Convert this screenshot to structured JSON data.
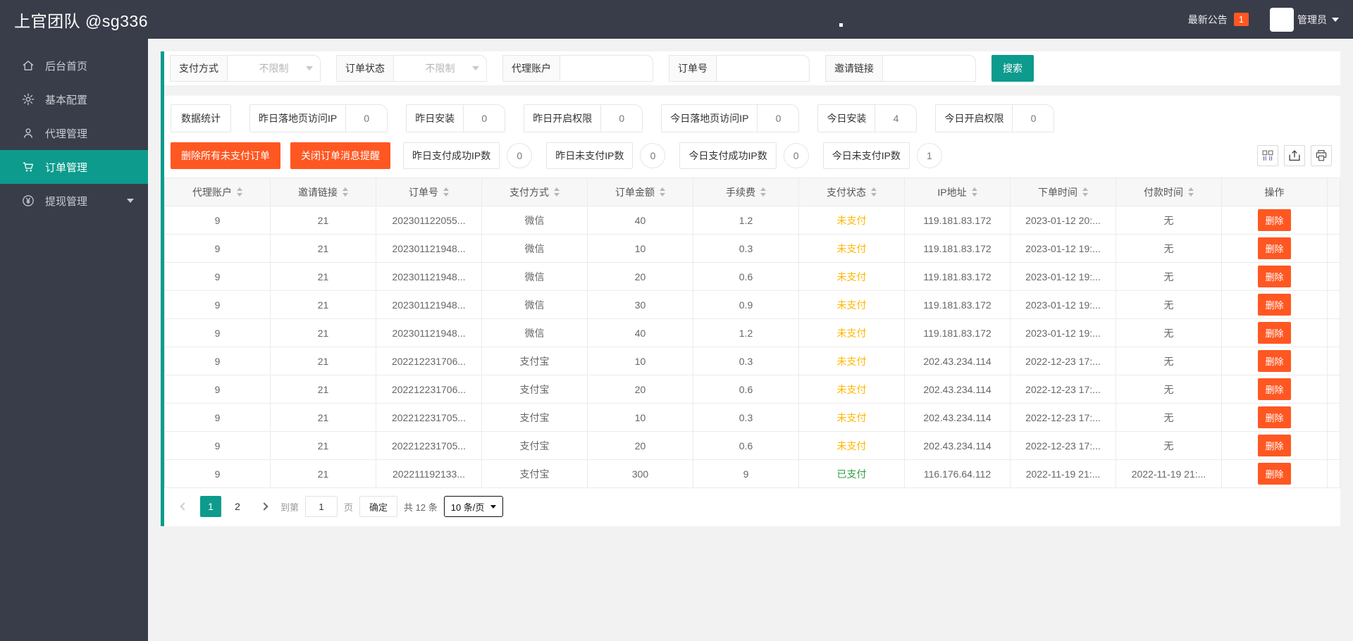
{
  "header": {
    "title": "上官团队 @sg336",
    "announcement_label": "最新公告",
    "announcement_count": "1",
    "user_label": "管理员"
  },
  "sidebar": {
    "items": [
      {
        "label": "后台首页",
        "icon": "home-icon",
        "active": false,
        "has_submenu": false
      },
      {
        "label": "基本配置",
        "icon": "gear-icon",
        "active": false,
        "has_submenu": false
      },
      {
        "label": "代理管理",
        "icon": "users-icon",
        "active": false,
        "has_submenu": false
      },
      {
        "label": "订单管理",
        "icon": "cart-icon",
        "active": true,
        "has_submenu": false
      },
      {
        "label": "提现管理",
        "icon": "yen-icon",
        "active": false,
        "has_submenu": true
      }
    ]
  },
  "filters": {
    "groups": [
      {
        "label": "支付方式",
        "type": "select",
        "value": "不限制"
      },
      {
        "label": "订单状态",
        "type": "select",
        "value": "不限制"
      },
      {
        "label": "代理账户",
        "type": "input",
        "value": ""
      },
      {
        "label": "订单号",
        "type": "input",
        "value": ""
      },
      {
        "label": "邀请链接",
        "type": "input",
        "value": ""
      }
    ],
    "search_label": "搜索"
  },
  "stats": {
    "title": "数据统计",
    "items": [
      {
        "label": "昨日落地页访问IP",
        "value": "0"
      },
      {
        "label": "昨日安装",
        "value": "0"
      },
      {
        "label": "昨日开启权限",
        "value": "0"
      },
      {
        "label": "今日落地页访问IP",
        "value": "0"
      },
      {
        "label": "今日安装",
        "value": "4"
      },
      {
        "label": "今日开启权限",
        "value": "0"
      }
    ]
  },
  "actions": {
    "buttons": [
      {
        "label": "删除所有未支付订单"
      },
      {
        "label": "关闭订单消息提醒"
      }
    ],
    "counters": [
      {
        "label": "昨日支付成功IP数",
        "value": "0"
      },
      {
        "label": "昨日未支付IP数",
        "value": "0"
      },
      {
        "label": "今日支付成功IP数",
        "value": "0"
      },
      {
        "label": "今日未支付IP数",
        "value": "1"
      }
    ],
    "tools": [
      {
        "name": "columns-icon"
      },
      {
        "name": "export-icon"
      },
      {
        "name": "print-icon"
      }
    ]
  },
  "table": {
    "columns": [
      {
        "label": "代理账户",
        "sortable": true
      },
      {
        "label": "邀请链接",
        "sortable": true
      },
      {
        "label": "订单号",
        "sortable": true
      },
      {
        "label": "支付方式",
        "sortable": true
      },
      {
        "label": "订单金额",
        "sortable": true
      },
      {
        "label": "手续费",
        "sortable": true
      },
      {
        "label": "支付状态",
        "sortable": true
      },
      {
        "label": "IP地址",
        "sortable": true
      },
      {
        "label": "下单时间",
        "sortable": true
      },
      {
        "label": "付款时间",
        "sortable": true
      },
      {
        "label": "操作",
        "sortable": false
      }
    ],
    "row_action_label": "删除",
    "status_styles": {
      "未支付": "#ffb800",
      "已支付": "#2f9e44"
    },
    "rows": [
      {
        "agent": "9",
        "invite": "21",
        "order_no": "202301122055...",
        "pay_method": "微信",
        "amount": "40",
        "fee": "1.2",
        "status": "未支付",
        "ip": "119.181.83.172",
        "order_time": "2023-01-12 20:...",
        "pay_time": "无"
      },
      {
        "agent": "9",
        "invite": "21",
        "order_no": "202301121948...",
        "pay_method": "微信",
        "amount": "10",
        "fee": "0.3",
        "status": "未支付",
        "ip": "119.181.83.172",
        "order_time": "2023-01-12 19:...",
        "pay_time": "无"
      },
      {
        "agent": "9",
        "invite": "21",
        "order_no": "202301121948...",
        "pay_method": "微信",
        "amount": "20",
        "fee": "0.6",
        "status": "未支付",
        "ip": "119.181.83.172",
        "order_time": "2023-01-12 19:...",
        "pay_time": "无"
      },
      {
        "agent": "9",
        "invite": "21",
        "order_no": "202301121948...",
        "pay_method": "微信",
        "amount": "30",
        "fee": "0.9",
        "status": "未支付",
        "ip": "119.181.83.172",
        "order_time": "2023-01-12 19:...",
        "pay_time": "无"
      },
      {
        "agent": "9",
        "invite": "21",
        "order_no": "202301121948...",
        "pay_method": "微信",
        "amount": "40",
        "fee": "1.2",
        "status": "未支付",
        "ip": "119.181.83.172",
        "order_time": "2023-01-12 19:...",
        "pay_time": "无"
      },
      {
        "agent": "9",
        "invite": "21",
        "order_no": "202212231706...",
        "pay_method": "支付宝",
        "amount": "10",
        "fee": "0.3",
        "status": "未支付",
        "ip": "202.43.234.114",
        "order_time": "2022-12-23 17:...",
        "pay_time": "无"
      },
      {
        "agent": "9",
        "invite": "21",
        "order_no": "202212231706...",
        "pay_method": "支付宝",
        "amount": "20",
        "fee": "0.6",
        "status": "未支付",
        "ip": "202.43.234.114",
        "order_time": "2022-12-23 17:...",
        "pay_time": "无"
      },
      {
        "agent": "9",
        "invite": "21",
        "order_no": "202212231705...",
        "pay_method": "支付宝",
        "amount": "10",
        "fee": "0.3",
        "status": "未支付",
        "ip": "202.43.234.114",
        "order_time": "2022-12-23 17:...",
        "pay_time": "无"
      },
      {
        "agent": "9",
        "invite": "21",
        "order_no": "202212231705...",
        "pay_method": "支付宝",
        "amount": "20",
        "fee": "0.6",
        "status": "未支付",
        "ip": "202.43.234.114",
        "order_time": "2022-12-23 17:...",
        "pay_time": "无"
      },
      {
        "agent": "9",
        "invite": "21",
        "order_no": "202211192133...",
        "pay_method": "支付宝",
        "amount": "300",
        "fee": "9",
        "status": "已支付",
        "ip": "116.176.64.112",
        "order_time": "2022-11-19 21:...",
        "pay_time": "2022-11-19 21:..."
      }
    ]
  },
  "pagination": {
    "pages": [
      "1",
      "2"
    ],
    "current_page": "1",
    "goto_label": "到第",
    "goto_value": "1",
    "goto_unit": "页",
    "confirm_label": "确定",
    "total_label": "共 12 条",
    "per_page_label": "10 条/页"
  },
  "colors": {
    "accent_teal": "#0c9b8d",
    "danger_orange": "#ff5722",
    "status_unpaid": "#ffb800",
    "status_paid": "#2f9e44",
    "header_bg": "#393d49"
  }
}
